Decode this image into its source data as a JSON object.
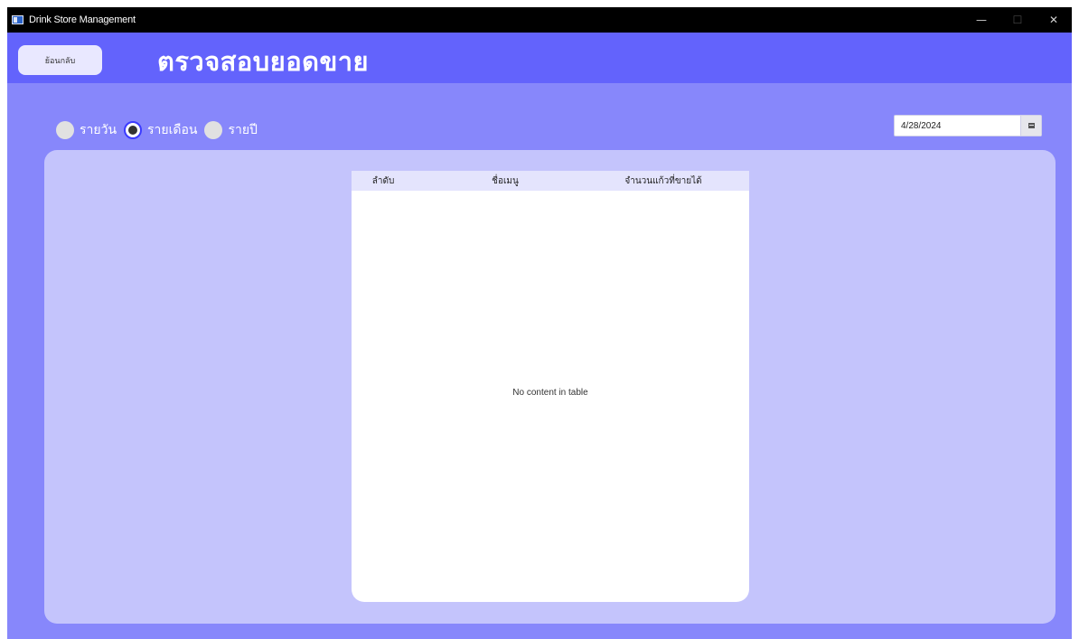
{
  "window": {
    "title": "Drink Store Management",
    "controls": {
      "minimize": "—",
      "maximize": "☐",
      "close": "✕"
    }
  },
  "header": {
    "back_label": "ย้อนกลับ",
    "title": "ตรวจสอบยอดขาย"
  },
  "filters": {
    "options": [
      {
        "label": "รายวัน",
        "selected": false
      },
      {
        "label": "รายเดือน",
        "selected": true
      },
      {
        "label": "รายปี",
        "selected": false
      }
    ]
  },
  "date_picker": {
    "value": "4/28/2024",
    "icon": "calendar-icon"
  },
  "table": {
    "columns": [
      "ลำดับ",
      "ชื่อเมนู",
      "จำนวนแก้วที่ขายได้"
    ],
    "rows": [],
    "empty_text": "No content in table"
  },
  "colors": {
    "background": "#8787fb",
    "header": "#6363fc",
    "panel": "#c4c4fc",
    "table_header": "#e4e4fd"
  }
}
